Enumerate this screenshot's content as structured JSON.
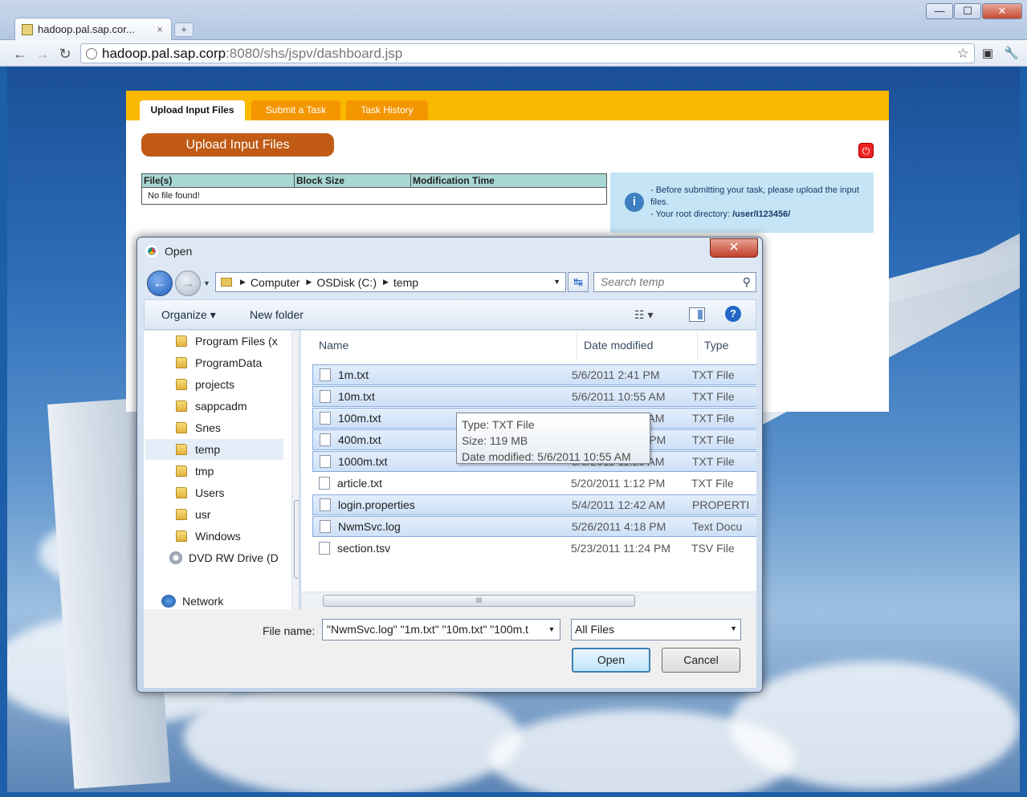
{
  "browser": {
    "tab_title": "hadoop.pal.sap.cor...",
    "tab_close": "×",
    "new_tab": "+",
    "url_host": "hadoop.pal.sap.corp",
    "url_rest": ":8080/shs/jspv/dashboard.jsp",
    "window_controls": {
      "minimize": "—",
      "maximize": "☐",
      "close": "✕"
    },
    "nav_icons": {
      "back": "←",
      "forward": "→",
      "reload": "↻",
      "star": "☆",
      "page_icon": "▣",
      "wrench_icon": "🔧"
    }
  },
  "app": {
    "tabs": [
      {
        "label": "Upload Input Files",
        "active": true
      },
      {
        "label": "Submit a Task",
        "active": false
      },
      {
        "label": "Task History",
        "active": false
      }
    ],
    "upload_button": "Upload Input Files",
    "power_icon": "⏻",
    "table": {
      "headers": [
        "File(s)",
        "Block Size",
        "Modification Time"
      ],
      "empty_message": "No file found!"
    },
    "info": {
      "icon": "i",
      "line1": "- Before submitting your task, please upload the input files.",
      "line2_prefix": "- Your root directory: ",
      "root_dir": "/user/I123456/"
    }
  },
  "dialog": {
    "title": "Open",
    "close": "✕",
    "back": "←",
    "forward": "→",
    "breadcrumb": [
      "Computer",
      "OSDisk (C:)",
      "temp"
    ],
    "crumb_sep": "▶",
    "dropdown_arrow": "▼",
    "refresh_icon": "↹",
    "search_placeholder": "Search temp",
    "search_icon": "⚲",
    "organize": "Organize ▾",
    "new_folder": "New folder",
    "view_icon": "☷ ▾",
    "help": "?",
    "nav_items": [
      {
        "label": "Program Files (x",
        "kind": "folder"
      },
      {
        "label": "ProgramData",
        "kind": "folder"
      },
      {
        "label": "projects",
        "kind": "folder"
      },
      {
        "label": "sappcadm",
        "kind": "folder"
      },
      {
        "label": "Snes",
        "kind": "folder"
      },
      {
        "label": "temp",
        "kind": "folder",
        "selected": true
      },
      {
        "label": "tmp",
        "kind": "folder"
      },
      {
        "label": "Users",
        "kind": "folder"
      },
      {
        "label": "usr",
        "kind": "folder"
      },
      {
        "label": "Windows",
        "kind": "folder"
      },
      {
        "label": "DVD RW Drive (D",
        "kind": "drive"
      },
      {
        "label": "Network",
        "kind": "network"
      }
    ],
    "columns": [
      "Name",
      "Date modified",
      "Type"
    ],
    "files": [
      {
        "name": "1m.txt",
        "date": "5/6/2011 2:41 PM",
        "type": "TXT File",
        "selected": true
      },
      {
        "name": "10m.txt",
        "date": "5/6/2011 10:55 AM",
        "type": "TXT File",
        "selected": true
      },
      {
        "name": "100m.txt",
        "date": "5/6/2011 11:09 AM",
        "type": "TXT File",
        "selected": true
      },
      {
        "name": "400m.txt",
        "date": "5/6/2011 12:35 PM",
        "type": "TXT File",
        "selected": true
      },
      {
        "name": "1000m.txt",
        "date": "5/6/2011 11:29 AM",
        "type": "TXT File",
        "selected": true
      },
      {
        "name": "article.txt",
        "date": "5/20/2011 1:12 PM",
        "type": "TXT File",
        "selected": false
      },
      {
        "name": "login.properties",
        "date": "5/4/2011 12:42 AM",
        "type": "PROPERTI",
        "selected": true
      },
      {
        "name": "NwmSvc.log",
        "date": "5/26/2011 4:18 PM",
        "type": "Text Docu",
        "selected": true
      },
      {
        "name": "section.tsv",
        "date": "5/23/2011 11:24 PM",
        "type": "TSV File",
        "selected": false
      }
    ],
    "tooltip": {
      "type": "Type: TXT File",
      "size": "Size: 119 MB",
      "modified": "Date modified: 5/6/2011 10:55 AM"
    },
    "scroll_grip": "III",
    "file_name_label": "File name:",
    "file_name_value": "\"NwmSvc.log\" \"1m.txt\" \"10m.txt\" \"100m.t",
    "filter": "All Files",
    "open_button": "Open",
    "cancel_button": "Cancel"
  }
}
